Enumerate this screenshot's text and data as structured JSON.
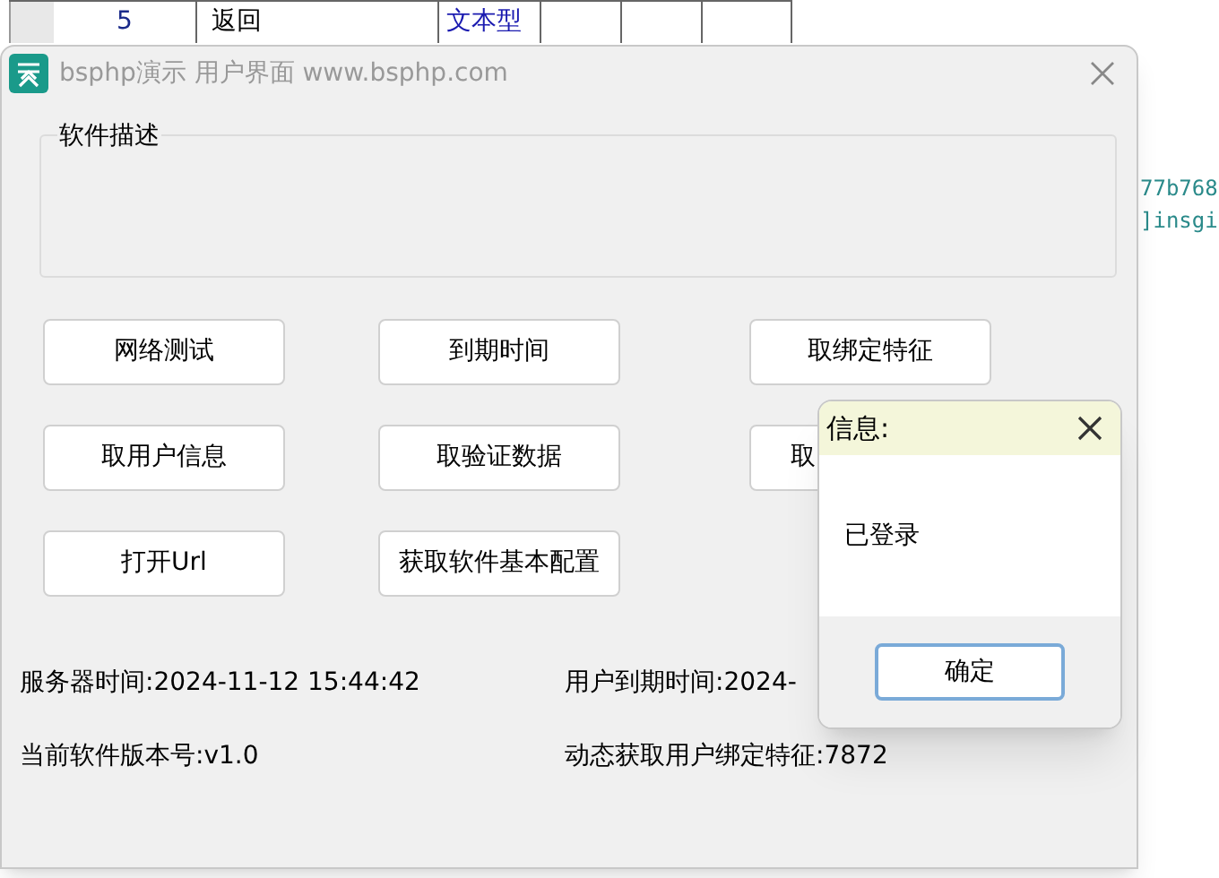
{
  "background_table": {
    "row": [
      {
        "text": "5",
        "kind": "number"
      },
      {
        "text": "返回",
        "kind": "plain"
      },
      {
        "text": "文本型",
        "kind": "type"
      },
      {
        "kind": "empty"
      },
      {
        "kind": "empty"
      },
      {
        "kind": "empty"
      }
    ]
  },
  "background_code": [
    "77b768",
    "]insgi"
  ],
  "window": {
    "title": "bsphp演示 用户界面 www.bsphp.com"
  },
  "description_group": {
    "label": "软件描述"
  },
  "buttons": [
    [
      "网络测试",
      "到期时间",
      "取绑定特征"
    ],
    [
      "取用户信息",
      "取验证数据",
      "取"
    ],
    [
      "打开Url",
      "获取软件基本配置"
    ]
  ],
  "status": [
    [
      "服务器时间:2024-11-12 15:44:42",
      "用户到期时间:2024-"
    ],
    [
      "当前软件版本号:v1.0",
      "动态获取用户绑定特征:7872"
    ]
  ],
  "dialog": {
    "title": "信息:",
    "message": "已登录",
    "ok_button": "确定"
  }
}
